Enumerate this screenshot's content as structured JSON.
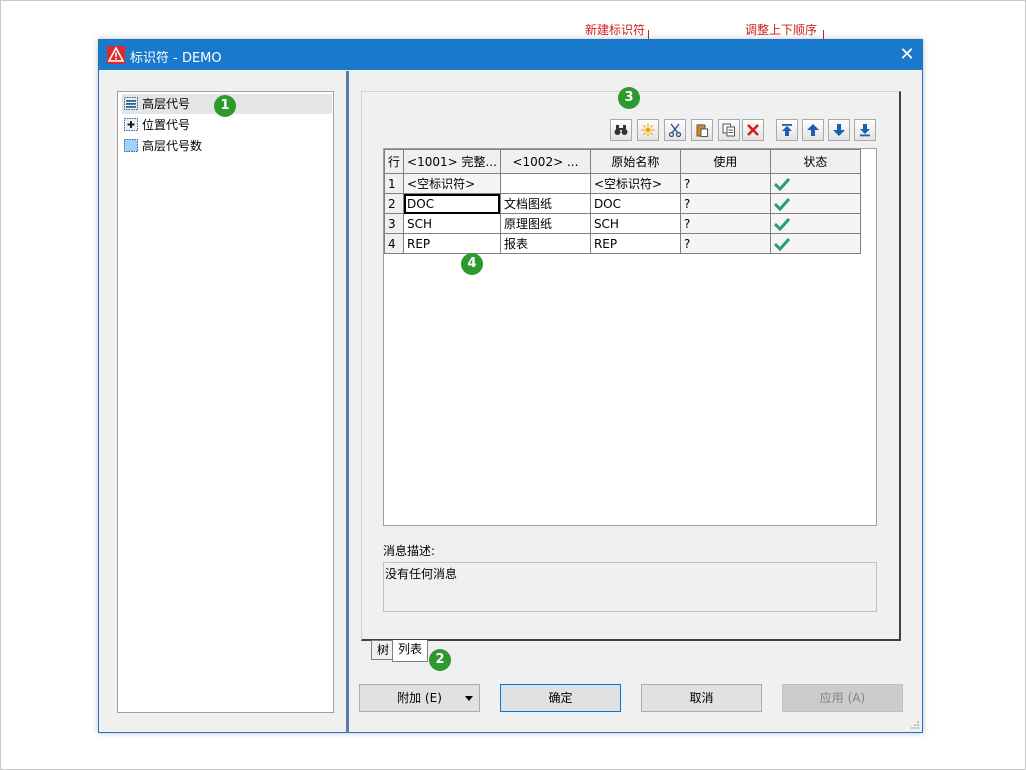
{
  "annotations": {
    "new_identifier": "新建标识符",
    "adjust_order": "调整上下顺序"
  },
  "window": {
    "title": "标识符 - DEMO",
    "close_glyph": "✕"
  },
  "tree": {
    "items": [
      {
        "label": "高层代号",
        "icon": "higher-level-code-icon"
      },
      {
        "label": "位置代号",
        "icon": "location-code-icon"
      },
      {
        "label": "高层代号数",
        "icon": "higher-level-code-count-icon"
      }
    ]
  },
  "badges": [
    "1",
    "2",
    "3",
    "4"
  ],
  "table": {
    "headers": [
      "行",
      "<1001> 完整...",
      "<1002> ...",
      "原始名称",
      "使用",
      "状态"
    ],
    "rows": [
      {
        "num": "1",
        "c1": "<空标识符>",
        "c2": "",
        "c3": "<空标识符>",
        "c4": "?",
        "status": "check-icon"
      },
      {
        "num": "2",
        "c1": "DOC",
        "c2": "文档图纸",
        "c3": "DOC",
        "c4": "?",
        "status": "check-icon"
      },
      {
        "num": "3",
        "c1": "SCH",
        "c2": "原理图纸",
        "c3": "SCH",
        "c4": "?",
        "status": "check-icon"
      },
      {
        "num": "4",
        "c1": "REP",
        "c2": "报表",
        "c3": "REP",
        "c4": "?",
        "status": "check-icon"
      }
    ]
  },
  "message": {
    "label": "消息描述:",
    "text": "没有任何消息"
  },
  "tabs": [
    "树",
    "列表"
  ],
  "buttons": {
    "append": "附加 (E)",
    "ok": "确定",
    "cancel": "取消",
    "apply": "应用 (A)"
  },
  "colors": {
    "titlebar": "#1979ca",
    "badge": "#2e9a2e",
    "annotation": "#d02020",
    "check": "#2e9a6e"
  }
}
